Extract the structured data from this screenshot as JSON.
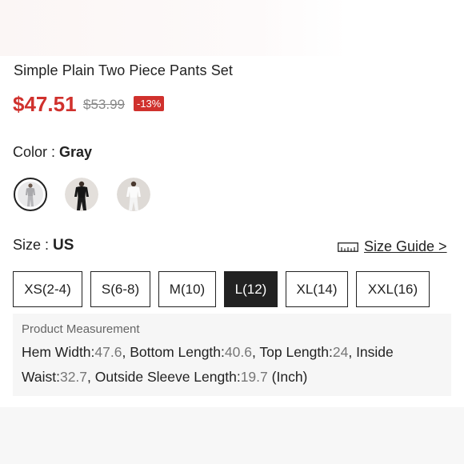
{
  "product": {
    "title": "Simple Plain Two Piece Pants Set",
    "price_current": "$47.51",
    "price_original": "$53.99",
    "discount": "-13%"
  },
  "color": {
    "label": "Color : ",
    "selected": "Gray",
    "swatches": [
      {
        "name": "Gray",
        "hex": "#b9b9bb",
        "selected": true
      },
      {
        "name": "Black",
        "hex": "#1e1e1e",
        "selected": false
      },
      {
        "name": "White",
        "hex": "#f2f2f2",
        "selected": false
      }
    ]
  },
  "size": {
    "label": "Size : ",
    "region": "US",
    "guide_label": "Size Guide >",
    "options": [
      "XS(2-4)",
      "S(6-8)",
      "M(10)",
      "L(12)",
      "XL(14)",
      "XXL(16)"
    ],
    "selected": "L(12)"
  },
  "measurement": {
    "title": "Product Measurement",
    "items": [
      {
        "label": "Hem Width:",
        "value": "47.6",
        "sep": ", "
      },
      {
        "label": "Bottom Length:",
        "value": "40.6",
        "sep": ", "
      },
      {
        "label": "Top Length:",
        "value": "24",
        "sep": ", "
      },
      {
        "label": "Inside Waist:",
        "value": "32.7",
        "sep": ", "
      },
      {
        "label": "Outside Sleeve Length:",
        "value": "19.7",
        "sep": " "
      }
    ],
    "unit": "(Inch)"
  },
  "colors": {
    "price_red": "#d0312d",
    "active_size_bg": "#222222",
    "measure_bg": "#f6f6f6"
  }
}
